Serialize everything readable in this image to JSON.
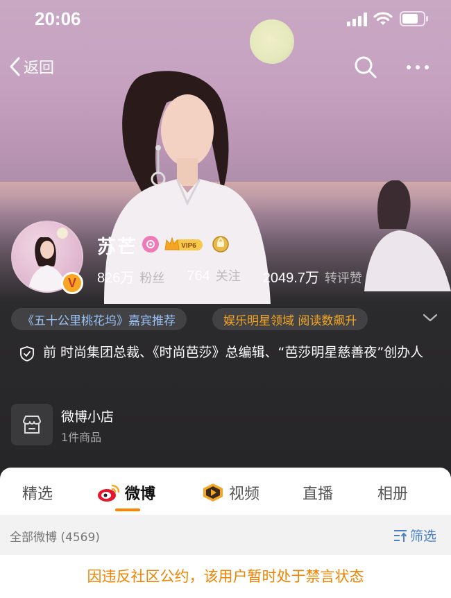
{
  "status_bar": {
    "time": "20:06"
  },
  "nav": {
    "back_label": "返回"
  },
  "profile": {
    "name": "苏芒",
    "vip_label": "VIP6",
    "verified_label": "V",
    "stats": [
      {
        "num": "826万",
        "label": "粉丝"
      },
      {
        "num": "764",
        "label": "关注"
      },
      {
        "num": "2049.7万",
        "label": "转评赞"
      }
    ]
  },
  "tags": {
    "tag1": "《五十公里桃花坞》嘉宾推荐",
    "tag2": "娱乐明星领域 阅读数飙升"
  },
  "bio": {
    "text": "前 时尚集团总裁、《时尚芭莎》总编辑、“芭莎明星慈善夜”创办人"
  },
  "shop": {
    "name": "微博小店",
    "sub": "1件商品"
  },
  "tabs": [
    {
      "label": "精选"
    },
    {
      "label": "微博"
    },
    {
      "label": "视频"
    },
    {
      "label": "直播"
    },
    {
      "label": "相册"
    }
  ],
  "filter": {
    "all_label": "全部微博 (4569)",
    "filter_label": "筛选"
  },
  "notice": {
    "text": "因违反社区公约，该用户暂时处于禁言状态"
  },
  "colors": {
    "accent": "#ff8200",
    "link_blue": "#4a7fc5",
    "notice_orange": "#f08300",
    "tag_orange": "#f6a623"
  },
  "icons": [
    "signal-icon",
    "wifi-icon",
    "battery-icon",
    "back-chevron-icon",
    "search-icon",
    "more-icon",
    "heart-badge-icon",
    "vip-crown-icon",
    "gold-badge-icon",
    "verified-v-icon",
    "chevron-down-icon",
    "shield-icon",
    "shop-icon",
    "weibo-logo-icon",
    "video-icon",
    "filter-icon"
  ]
}
